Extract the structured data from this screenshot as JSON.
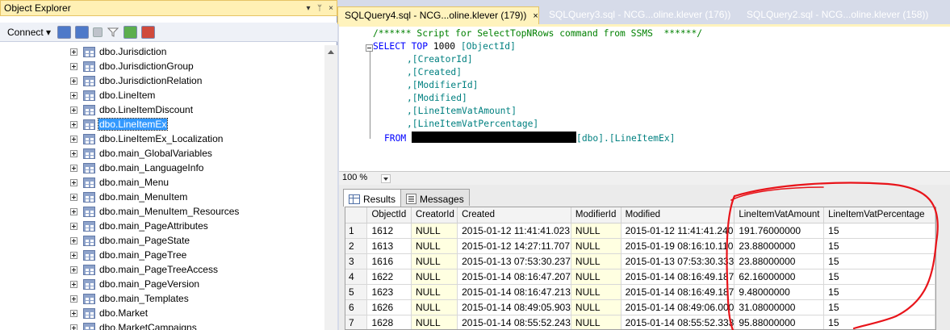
{
  "object_explorer": {
    "title": "Object Explorer",
    "pin_glyphs": [
      "▾",
      "ᛘ",
      "×"
    ],
    "connect_label": "Connect ▾",
    "items": [
      "dbo.Jurisdiction",
      "dbo.JurisdictionGroup",
      "dbo.JurisdictionRelation",
      "dbo.LineItem",
      "dbo.LineItemDiscount",
      "dbo.LineItemEx",
      "dbo.LineItemEx_Localization",
      "dbo.main_GlobalVariables",
      "dbo.main_LanguageInfo",
      "dbo.main_Menu",
      "dbo.main_MenuItem",
      "dbo.main_MenuItem_Resources",
      "dbo.main_PageAttributes",
      "dbo.main_PageState",
      "dbo.main_PageTree",
      "dbo.main_PageTreeAccess",
      "dbo.main_PageVersion",
      "dbo.main_Templates",
      "dbo.Market",
      "dbo.MarketCampaigns"
    ],
    "selected_item": "dbo.LineItemEx"
  },
  "tabs": [
    {
      "label": "SQLQuery4.sql - NCG...oline.klever (179))",
      "close": "×"
    },
    {
      "label": "SQLQuery3.sql - NCG...oline.klever (176))"
    },
    {
      "label": "SQLQuery2.sql - NCG...oline.klever (158))"
    }
  ],
  "editor": {
    "comment": "/****** Script for SelectTopNRows command from SSMS  ******/",
    "select_kw": "SELECT",
    "top_kw": "TOP",
    "top_n": "1000",
    "first_col": "[ObjectId]",
    "columns": [
      ",[CreatorId]",
      ",[Created]",
      ",[ModifierId]",
      ",[Modified]",
      ",[LineItemVatAmount]",
      ",[LineItemVatPercentage]"
    ],
    "from_kw": "FROM",
    "from_target": "[dbo].[LineItemEx]"
  },
  "zoom": "100 %",
  "result_tabs": {
    "results": "Results",
    "messages": "Messages"
  },
  "grid": {
    "headers": [
      "ObjectId",
      "CreatorId",
      "Created",
      "ModifierId",
      "Modified",
      "LineItemVatAmount",
      "LineItemVatPercentage"
    ],
    "rows": [
      [
        "1",
        "1612",
        "NULL",
        "2015-01-12 11:41:41.023",
        "NULL",
        "2015-01-12 11:41:41.240",
        "191.76000000",
        "15"
      ],
      [
        "2",
        "1613",
        "NULL",
        "2015-01-12 14:27:11.707",
        "NULL",
        "2015-01-19 08:16:10.110",
        "23.88000000",
        "15"
      ],
      [
        "3",
        "1616",
        "NULL",
        "2015-01-13 07:53:30.237",
        "NULL",
        "2015-01-13 07:53:30.333",
        "23.88000000",
        "15"
      ],
      [
        "4",
        "1622",
        "NULL",
        "2015-01-14 08:16:47.207",
        "NULL",
        "2015-01-14 08:16:49.187",
        "62.16000000",
        "15"
      ],
      [
        "5",
        "1623",
        "NULL",
        "2015-01-14 08:16:47.213",
        "NULL",
        "2015-01-14 08:16:49.187",
        "9.48000000",
        "15"
      ],
      [
        "6",
        "1626",
        "NULL",
        "2015-01-14 08:49:05.903",
        "NULL",
        "2015-01-14 08:49:06.000",
        "31.08000000",
        "15"
      ],
      [
        "7",
        "1628",
        "NULL",
        "2015-01-14 08:55:52.243",
        "NULL",
        "2015-01-14 08:55:52.333",
        "95.88000000",
        "15"
      ]
    ]
  },
  "colors": {
    "annotation": "#e8141a",
    "selection": "#3399ff",
    "tab_active": "#fff3bd"
  }
}
